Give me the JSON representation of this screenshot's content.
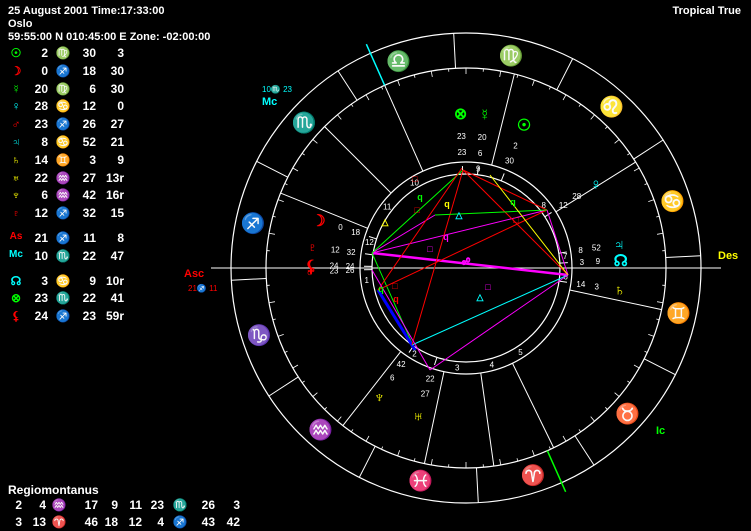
{
  "header": {
    "date_time": "25 August 2001 Time:17:33:00",
    "place": "Oslo",
    "coords": "59:55:00 N 010:45:00 E Zone: -02:00:00",
    "zodiac": "Tropical True"
  },
  "planets": [
    {
      "glyph": "☉",
      "color": "#00ff00",
      "deg": "2",
      "sign": "♍",
      "sign_color": "#00ff00",
      "min": "30",
      "sec": "3"
    },
    {
      "glyph": "☽",
      "color": "#ff0000",
      "deg": "0",
      "sign": "♐",
      "sign_color": "#ff0000",
      "min": "18",
      "sec": "30"
    },
    {
      "glyph": "☿",
      "color": "#00ff00",
      "deg": "20",
      "sign": "♍",
      "sign_color": "#00ff00",
      "min": "6",
      "sec": "30"
    },
    {
      "glyph": "♀",
      "color": "#00ffff",
      "deg": "28",
      "sign": "♋",
      "sign_color": "#00ffff",
      "min": "12",
      "sec": "0"
    },
    {
      "glyph": "♂",
      "color": "#ff0000",
      "deg": "23",
      "sign": "♐",
      "sign_color": "#ff0000",
      "min": "26",
      "sec": "27"
    },
    {
      "glyph": "♃",
      "color": "#00ffff",
      "deg": "8",
      "sign": "♋",
      "sign_color": "#00ffff",
      "min": "52",
      "sec": "21"
    },
    {
      "glyph": "♄",
      "color": "#ffff00",
      "deg": "14",
      "sign": "♊",
      "sign_color": "#ffff00",
      "min": "3",
      "sec": "9"
    },
    {
      "glyph": "♅",
      "color": "#ffff00",
      "deg": "22",
      "sign": "♒",
      "sign_color": "#ffff00",
      "min": "27",
      "sec": "13r"
    },
    {
      "glyph": "♆",
      "color": "#ffff00",
      "deg": "6",
      "sign": "♒",
      "sign_color": "#ffff00",
      "min": "42",
      "sec": "16r"
    },
    {
      "glyph": "♇",
      "color": "#ff0000",
      "deg": "12",
      "sign": "♐",
      "sign_color": "#ff0000",
      "min": "32",
      "sec": "15"
    },
    {
      "glyph": "As",
      "color": "#ff0000",
      "deg": "21",
      "sign": "♐",
      "sign_color": "#ff0000",
      "min": "11",
      "sec": "8"
    },
    {
      "glyph": "Mc",
      "color": "#00ffff",
      "deg": "10",
      "sign": "♏",
      "sign_color": "#00ffff",
      "min": "22",
      "sec": "47"
    },
    {
      "glyph": "☊",
      "color": "#00ffff",
      "deg": "3",
      "sign": "♋",
      "sign_color": "#00ffff",
      "min": "9",
      "sec": "10r"
    },
    {
      "glyph": "⊗",
      "color": "#00ff00",
      "deg": "23",
      "sign": "♏",
      "sign_color": "#00ffff",
      "min": "22",
      "sec": "41"
    },
    {
      "glyph": "⚸",
      "color": "#ff0000",
      "deg": "24",
      "sign": "♐",
      "sign_color": "#ff0000",
      "min": "23",
      "sec": "59r"
    }
  ],
  "houses": {
    "system": "Regiomontanus",
    "rows": [
      [
        "2",
        "4",
        "♒",
        "17",
        "9",
        "11",
        "23",
        "♏",
        "26",
        "3"
      ],
      [
        "3",
        "13",
        "♈",
        "46",
        "18",
        "12",
        "4",
        "♐",
        "43",
        "42"
      ]
    ],
    "sign_colors": [
      [
        "#ffff00",
        "#00ffff"
      ],
      [
        "#ff0000",
        "#ff0000"
      ]
    ]
  },
  "wheel": {
    "angle_labels": {
      "asc": "Asc",
      "des": "Des",
      "mc": "Mc",
      "ic": "Ic"
    },
    "asc_degree": "21",
    "asc_minute": "11",
    "mc_degree": "10",
    "mc_minute": "23",
    "zodiac_ring": [
      {
        "glyph": "♍",
        "color": "#00ff00",
        "ang": 78
      },
      {
        "glyph": "♌",
        "color": "#ff0000",
        "ang": 48
      },
      {
        "glyph": "♋",
        "color": "#00ffff",
        "ang": 18
      },
      {
        "glyph": "♊",
        "color": "#ffff00",
        "ang": -12
      },
      {
        "glyph": "♉",
        "color": "#00ff00",
        "ang": -42
      },
      {
        "glyph": "♈",
        "color": "#ff0000",
        "ang": -72
      },
      {
        "glyph": "♓",
        "color": "#00ffff",
        "ang": -102
      },
      {
        "glyph": "♒",
        "color": "#ffff00",
        "ang": -132
      },
      {
        "glyph": "♑",
        "color": "#00ff00",
        "ang": -162
      },
      {
        "glyph": "♐",
        "color": "#ff0000",
        "ang": 168
      },
      {
        "glyph": "♏",
        "color": "#00ffff",
        "ang": 138
      },
      {
        "glyph": "♎",
        "color": "#ffff00",
        "ang": 108
      }
    ],
    "house_numbers": [
      "1",
      "2",
      "3",
      "4",
      "5",
      "6",
      "7",
      "8",
      "9",
      "10",
      "11",
      "12"
    ],
    "planet_labels": [
      {
        "glyph": "☿",
        "color": "#00ff00",
        "deg": "20",
        "min": "6",
        "ang": 83
      },
      {
        "glyph": "☉",
        "color": "#00ff00",
        "deg": "2",
        "min": "30",
        "ang": 68
      },
      {
        "glyph": "⊗",
        "color": "#00ff00",
        "deg": "23",
        "min": "23",
        "ang": 92
      },
      {
        "glyph": "♀",
        "color": "#00ffff",
        "deg": "28",
        "min": "12",
        "ang": 33
      },
      {
        "glyph": "♃",
        "color": "#00ffff",
        "deg": "52",
        "min": "8",
        "ang": 9
      },
      {
        "glyph": "☊",
        "color": "#00ffff",
        "deg": "9",
        "min": "3",
        "ang": 3
      },
      {
        "glyph": "♄",
        "color": "#ffff00",
        "deg": "3",
        "min": "14",
        "ang": -8
      },
      {
        "glyph": "♆",
        "color": "#ffff00",
        "deg": "6",
        "min": "42",
        "ang": -124
      },
      {
        "glyph": "♅",
        "color": "#ffff00",
        "deg": "27",
        "min": "22",
        "ang": -108
      },
      {
        "glyph": "☽",
        "color": "#ff0000",
        "deg": "0",
        "min": "18",
        "ang": 162
      },
      {
        "glyph": "♇",
        "color": "#ff0000",
        "deg": "12",
        "min": "32",
        "ang": 172
      },
      {
        "glyph": "♂",
        "color": "#ff0000",
        "deg": "23",
        "min": "26",
        "ang": 181
      },
      {
        "glyph": "⚸",
        "color": "#ff0000",
        "deg": "24",
        "min": "24",
        "ang": 179
      }
    ],
    "aspect_symbols": [
      "q",
      "q",
      "q",
      "q",
      "q",
      "q",
      "□",
      "□",
      "□",
      "□",
      "□",
      "□",
      "△",
      "△",
      "△",
      "☍",
      "☍"
    ]
  }
}
